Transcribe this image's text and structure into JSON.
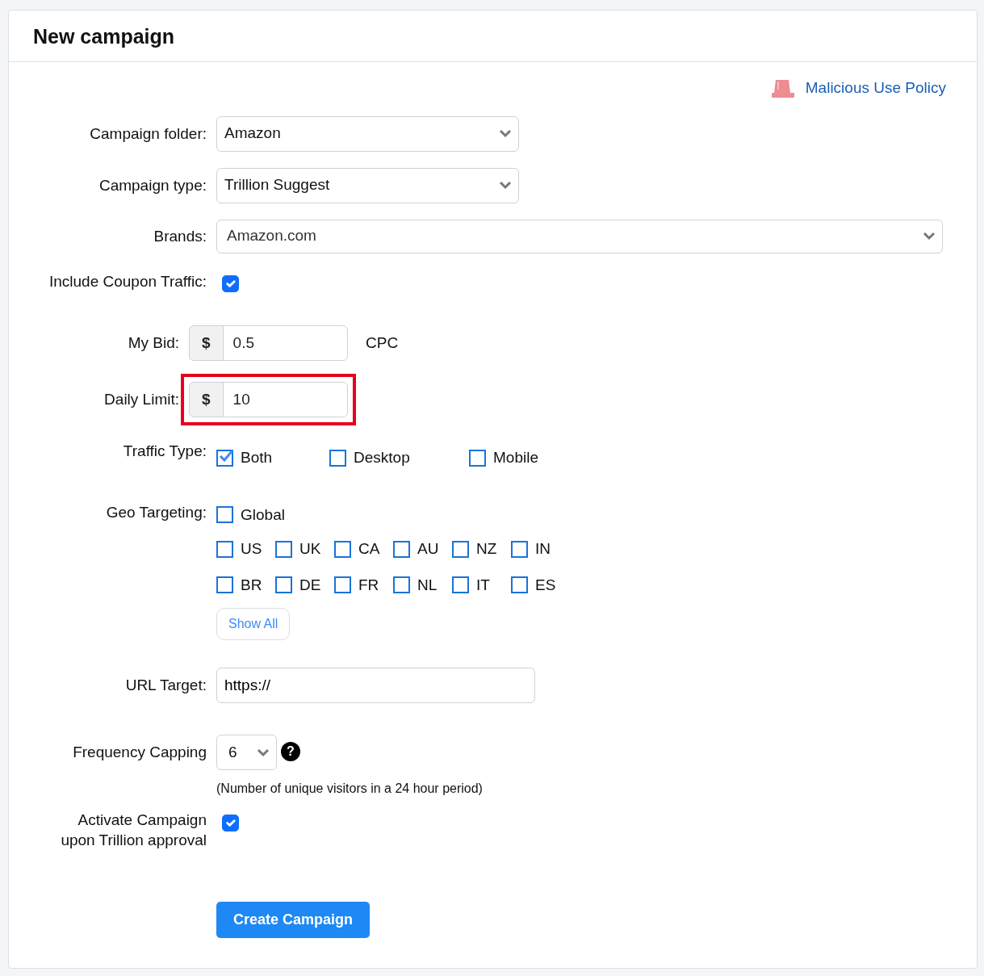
{
  "card": {
    "title": "New campaign"
  },
  "policy_link": {
    "label": "Malicious Use Policy"
  },
  "fields": [
    {
      "kind": "select",
      "label": "Campaign folder:",
      "value": "Amazon"
    },
    {
      "kind": "select",
      "label": "Campaign type:",
      "value": "Trillion Suggest"
    },
    {
      "kind": "wide-select",
      "label": "Brands:",
      "value": "Amazon.com"
    },
    {
      "kind": "checkbox",
      "label": "Include Coupon Traffic:",
      "checked": true
    },
    {
      "kind": "money",
      "label": "My Bid:",
      "prefix": "$",
      "value": "0.5",
      "suffix": "CPC",
      "highlighted": false
    },
    {
      "kind": "money",
      "label": "Daily Limit:",
      "prefix": "$",
      "value": "10",
      "highlighted": true
    },
    {
      "kind": "options",
      "label": "Traffic Type:",
      "options": [
        {
          "label": "Both",
          "checked": true
        },
        {
          "label": "Desktop",
          "checked": false
        },
        {
          "label": "Mobile",
          "checked": false
        }
      ]
    },
    {
      "kind": "geo",
      "label": "Geo Targeting:",
      "global": {
        "label": "Global",
        "checked": false
      },
      "countries": [
        [
          {
            "label": "US",
            "checked": false
          },
          {
            "label": "UK",
            "checked": false
          },
          {
            "label": "CA",
            "checked": false
          },
          {
            "label": "AU",
            "checked": false
          },
          {
            "label": "NZ",
            "checked": false
          },
          {
            "label": "IN",
            "checked": false
          }
        ],
        [
          {
            "label": "BR",
            "checked": false
          },
          {
            "label": "DE",
            "checked": false
          },
          {
            "label": "FR",
            "checked": false
          },
          {
            "label": "NL",
            "checked": false
          },
          {
            "label": "IT",
            "checked": false
          },
          {
            "label": "ES",
            "checked": false
          }
        ]
      ],
      "button": "Show All"
    },
    {
      "kind": "text",
      "label": "URL Target:",
      "value": "https://"
    },
    {
      "kind": "frequency",
      "label": "Frequency Capping",
      "value": "6",
      "help": "?",
      "note": "(Number of unique visitors in a 24 hour period)"
    },
    {
      "kind": "checkbox",
      "label": "Activate Campaign upon Trillion approval",
      "checked": true
    }
  ],
  "submit": "Create Campaign"
}
